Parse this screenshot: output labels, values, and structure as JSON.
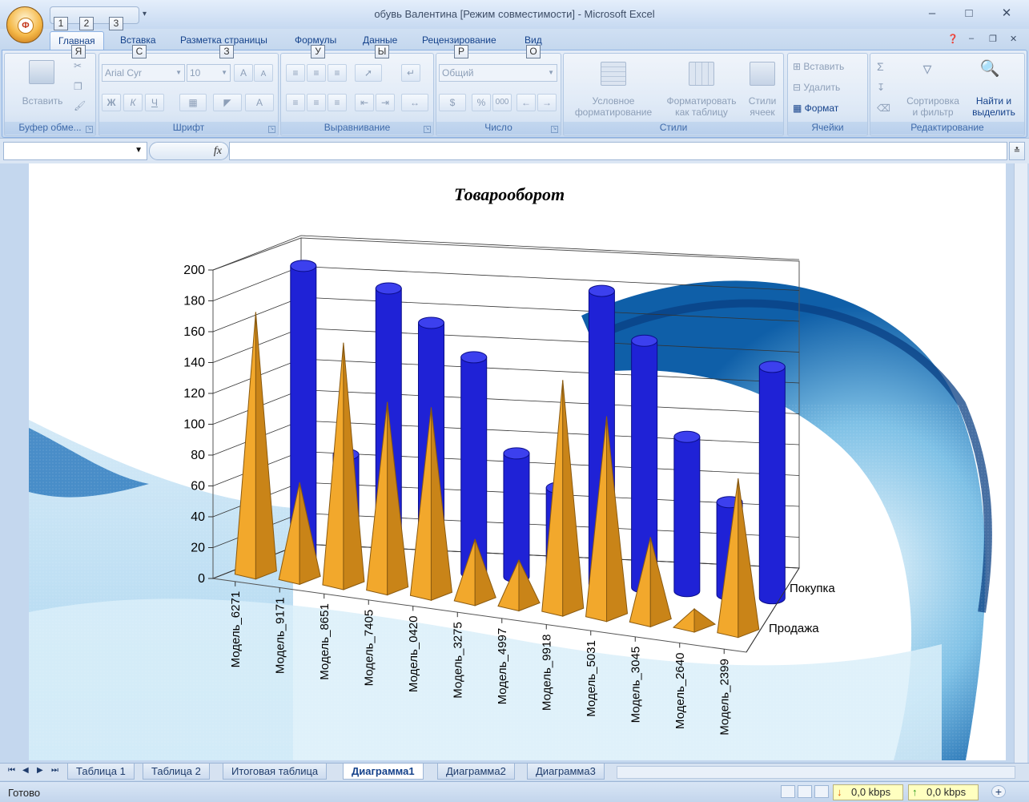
{
  "window": {
    "title": "обувь Валентина  [Режим совместимости] - Microsoft Excel"
  },
  "office_button": {
    "letter": "Ф"
  },
  "quick_access": {
    "keytips": [
      "1",
      "2",
      "3"
    ]
  },
  "ribbon_tabs": [
    {
      "label": "Главная",
      "keytip": "Я",
      "active": true
    },
    {
      "label": "Вставка",
      "keytip": "С"
    },
    {
      "label": "Разметка страницы",
      "keytip": "З"
    },
    {
      "label": "Формулы",
      "keytip": "У"
    },
    {
      "label": "Данные",
      "keytip": "Ы"
    },
    {
      "label": "Рецензирование",
      "keytip": "Р"
    },
    {
      "label": "Вид",
      "keytip": "О"
    }
  ],
  "ribbon": {
    "clipboard": {
      "label": "Буфер обме...",
      "paste": "Вставить"
    },
    "font": {
      "label": "Шрифт",
      "font_name": "Arial Cyr",
      "font_size": "10",
      "bold": "Ж",
      "italic": "К",
      "underline": "Ч",
      "grow": "A",
      "shrink": "A"
    },
    "alignment": {
      "label": "Выравнивание"
    },
    "number": {
      "label": "Число",
      "format": "Общий",
      "percent": "%",
      "thousands": "000"
    },
    "styles": {
      "label": "Стили",
      "conditional": [
        "Условное",
        "форматирование"
      ],
      "as_table": [
        "Форматировать",
        "как таблицу"
      ],
      "cell_styles": [
        "Стили",
        "ячеек"
      ]
    },
    "cells": {
      "label": "Ячейки",
      "insert": "Вставить",
      "delete": "Удалить",
      "format": "Формат"
    },
    "editing": {
      "label": "Редактирование",
      "sort": [
        "Сортировка",
        "и фильтр"
      ],
      "find": [
        "Найти и",
        "выделить"
      ],
      "sigma": "Σ"
    }
  },
  "formula_bar": {
    "fx": "fx",
    "name_box": "",
    "formula": ""
  },
  "colors": {
    "series_buy": "#1f22d6",
    "series_sell": "#f2a82c",
    "accent": "#15428b"
  },
  "chart_data": {
    "type": "bar",
    "variant": "3d-column",
    "title": "Товарооборот",
    "categories": [
      "Модель_6271",
      "Модель_9171",
      "Модель_8651",
      "Модель_7405",
      "Модель_0420",
      "Модель_3275",
      "Модель_4997",
      "Модель_9918",
      "Модель_5031",
      "Модель_3045",
      "Модель_2640",
      "Модель_2399"
    ],
    "series": [
      {
        "name": "Продажа",
        "shape": "pyramid",
        "values": [
          170,
          63,
          157,
          122,
          122,
          40,
          30,
          150,
          130,
          55,
          12,
          100
        ]
      },
      {
        "name": "Покупка",
        "shape": "cylinder",
        "values": [
          190,
          70,
          180,
          160,
          140,
          80,
          60,
          190,
          160,
          100,
          60,
          150
        ]
      }
    ],
    "ylim": [
      0,
      200
    ],
    "yticks": [
      0,
      20,
      40,
      60,
      80,
      100,
      120,
      140,
      160,
      180,
      200
    ],
    "grid": true,
    "legend": "none",
    "background": "water-splash"
  },
  "sheet_tabs": [
    {
      "label": "Таблица 1"
    },
    {
      "label": "Таблица 2"
    },
    {
      "label": "Итоговая таблица"
    },
    {
      "label": "Диаграмма1",
      "active": true
    },
    {
      "label": "Диаграмма2"
    },
    {
      "label": "Диаграмма3"
    }
  ],
  "status": {
    "ready": "Готово",
    "download": "0,0 kbps",
    "upload": "0,0 kbps"
  }
}
